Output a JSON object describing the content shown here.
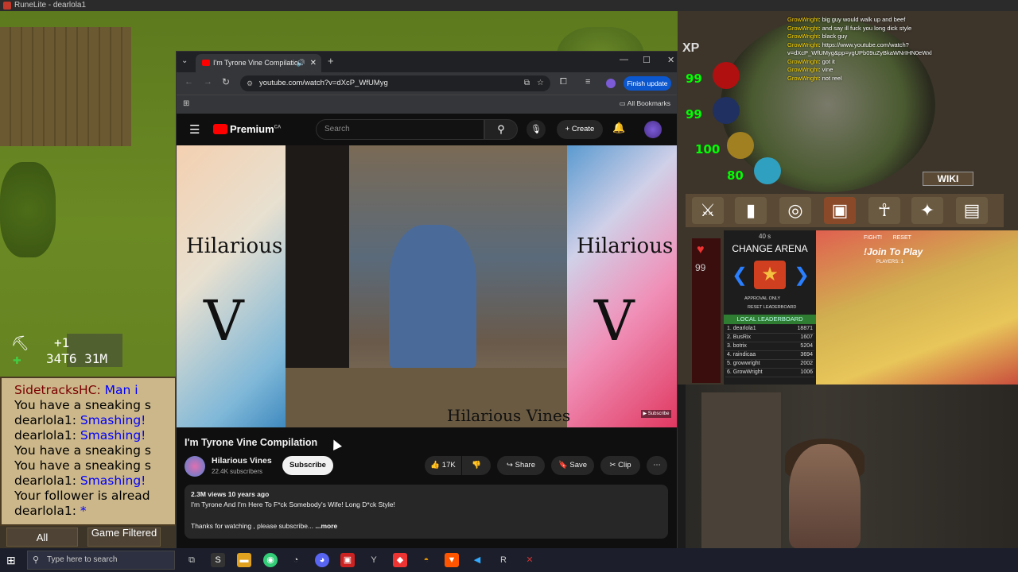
{
  "runelite": {
    "title": "RuneLite - dearlola1",
    "stats": {
      "plus": "+1",
      "xp": "34T6 31M"
    },
    "chat_lines": [
      {
        "prefix": "SidetracksHC: ",
        "msg": "Man i",
        "style": "red"
      },
      {
        "prefix": "You have a sneaking s",
        "msg": "",
        "style": "plain"
      },
      {
        "prefix": "dearlola1: ",
        "msg": "Smashing!",
        "style": "blue"
      },
      {
        "prefix": "dearlola1: ",
        "msg": "Smashing!",
        "style": "blue"
      },
      {
        "prefix": "You have a sneaking s",
        "msg": "",
        "style": "plain"
      },
      {
        "prefix": "You have a sneaking s",
        "msg": "",
        "style": "plain"
      },
      {
        "prefix": "dearlola1: ",
        "msg": "Smashing!",
        "style": "blue"
      },
      {
        "prefix": "Your follower is alread",
        "msg": "",
        "style": "plain"
      },
      {
        "prefix": "dearlola1: ",
        "msg": "*",
        "style": "blue"
      }
    ],
    "chat_tabs": [
      "All",
      "Game Filtered"
    ],
    "orbs": {
      "hp": "99",
      "prayer": "99",
      "run": "100",
      "spec": "80"
    },
    "xp_label": "XP",
    "hp_side": "99",
    "wiki": "WIKI"
  },
  "stream_chat": [
    {
      "name": "GrowWright",
      "msg": ": big guy would walk up and beef"
    },
    {
      "name": "GrowWright",
      "msg": ": and say ill fuck you long dick style"
    },
    {
      "name": "GrowWright",
      "msg": ": black guy"
    },
    {
      "name": "GrowWright",
      "msg": ": https://www.youtube.com/watch?v=dXcP_WfUMyg&pp=ygUPb09uZyBkaWNrIHN0eWxl"
    },
    {
      "name": "GrowWright",
      "msg": ": got it"
    },
    {
      "name": "GrowWright",
      "msg": ": vine"
    },
    {
      "name": "GrowWright",
      "msg": ": not reel"
    }
  ],
  "arena": {
    "timer": "40 s",
    "title": "CHANGE ARENA",
    "approval": "APPROVAL ONLY",
    "reset_lb": "RESET LEADERBOARD",
    "local_lb": "LOCAL LEADERBOARD",
    "rows": [
      {
        "rank": "1. dearlola1",
        "score": "18871"
      },
      {
        "rank": "2. BusRix",
        "score": "1607"
      },
      {
        "rank": "3. botrix",
        "score": "5204"
      },
      {
        "rank": "4. raindicaa",
        "score": "3694"
      },
      {
        "rank": "5. growwright",
        "score": "2002"
      },
      {
        "rank": "6. GrowWright",
        "score": "1006"
      }
    ]
  },
  "game3d": {
    "fight": "FIGHT!",
    "reset": "RESET",
    "join": "!Join To Play",
    "players": "PLAYERS: 1"
  },
  "browser": {
    "tab_title": "I'm Tyrone Vine Compilatio",
    "url": "youtube.com/watch?v=dXcP_WfUMyg",
    "finish_update": "Finish update",
    "all_bookmarks": "All Bookmarks"
  },
  "youtube": {
    "logo": "Premium",
    "logo_sup": "CA",
    "search_placeholder": "Search",
    "create": "Create",
    "video_left_text": "Hilarious",
    "video_right_text": "Hilarious",
    "video_bottom_text": "Hilarious Vines",
    "video_title": "I'm Tyrone Vine Compilation",
    "channel": "Hilarious Vines",
    "subscribers": "22.4K subscribers",
    "subscribe": "Subscribe",
    "likes": "17K",
    "share": "Share",
    "save": "Save",
    "clip": "Clip",
    "views_date": "2.3M views  10 years ago",
    "desc_line1": "I'm Tyrone And I'm Here To F*ck Somebody's Wife! Long D*ck Style!",
    "desc_line2": "Thanks for watching , please subscribe... ",
    "more": "...more"
  },
  "taskbar": {
    "search_placeholder": "Type here to search"
  },
  "colors": {
    "yt_red": "#ff0000",
    "chrome_blue": "#0b57d0",
    "osrs_chat_bg": "#cbb78a"
  }
}
